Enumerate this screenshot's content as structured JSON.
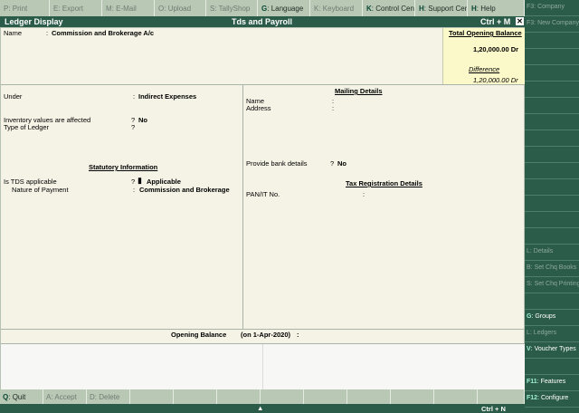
{
  "topbar": [
    {
      "key": "P",
      "label": "Print",
      "enabled": false,
      "w": 55
    },
    {
      "key": "E",
      "label": "Export",
      "enabled": false,
      "w": 58
    },
    {
      "key": "M",
      "label": "E-Mail",
      "enabled": false,
      "w": 58
    },
    {
      "key": "O",
      "label": "Upload",
      "enabled": false,
      "w": 57
    },
    {
      "key": "S",
      "label": "TallyShop",
      "enabled": false,
      "w": 57
    },
    {
      "key": "G",
      "label": "Language",
      "enabled": true,
      "w": 58
    },
    {
      "key": "K",
      "label": "Keyboard",
      "enabled": false,
      "w": 58
    },
    {
      "key": "K",
      "label": "Control Centre",
      "enabled": true,
      "w": 58
    },
    {
      "key": "H",
      "label": "Support Centre",
      "enabled": true,
      "w": 58
    },
    {
      "key": "H",
      "label": "Help",
      "enabled": true,
      "w": 63
    }
  ],
  "title": {
    "left": "Ledger Display",
    "center": "Tds and Payroll",
    "right": "Ctrl + M",
    "close": "✕"
  },
  "ledger": {
    "name_label": "Name",
    "name_value": "Commission and Brokerage A/c",
    "balance_title": "Total Opening Balance",
    "balance_value": "1,20,000.00 Dr",
    "difference_label": "Difference",
    "difference_value": "1,20,000.00 Dr",
    "under_label": "Under",
    "under_value": "Indirect Expenses",
    "inventory_label": "Inventory values are affected",
    "inventory_value": "No",
    "type_label": "Type of Ledger",
    "type_value": "",
    "statutory_title": "Statutory Information",
    "tds_label": "Is TDS applicable",
    "tds_value": "Applicable",
    "nature_label": "Nature of Payment",
    "nature_value": "Commission and Brokerage"
  },
  "mailing": {
    "title": "Mailing Details",
    "name_label": "Name",
    "address_label": "Address",
    "bank_label": "Provide bank details",
    "bank_value": "No",
    "tax_title": "Tax Registration Details",
    "pan_label": "PAN/IT No."
  },
  "opening": {
    "label": "Opening Balance",
    "date": "(on 1-Apr-2020)"
  },
  "bottombar": [
    {
      "key": "Q",
      "label": "Quit",
      "enabled": true,
      "w": 48
    },
    {
      "key": "A",
      "label": "Accept",
      "enabled": false,
      "w": 48
    },
    {
      "key": "D",
      "label": "Delete",
      "enabled": false,
      "w": 48
    },
    {
      "key": "",
      "label": "",
      "enabled": false,
      "w": 48
    },
    {
      "key": "",
      "label": "",
      "enabled": false,
      "w": 48
    },
    {
      "key": "",
      "label": "",
      "enabled": false,
      "w": 48
    },
    {
      "key": "",
      "label": "",
      "enabled": false,
      "w": 48
    },
    {
      "key": "",
      "label": "",
      "enabled": false,
      "w": 48
    },
    {
      "key": "",
      "label": "",
      "enabled": false,
      "w": 48
    },
    {
      "key": "",
      "label": "",
      "enabled": false,
      "w": 48
    },
    {
      "key": "",
      "label": "",
      "enabled": false,
      "w": 48
    },
    {
      "key": "",
      "label": "",
      "enabled": false,
      "w": 52
    }
  ],
  "statusbar": {
    "arrow": "▲",
    "shortcut": "Ctrl + N"
  },
  "rightpanel": [
    {
      "key": "F3",
      "label": "Company",
      "enabled": false
    },
    {
      "key": "F3",
      "label": "New Company",
      "enabled": false
    },
    {
      "key": "",
      "label": "",
      "enabled": false
    },
    {
      "key": "",
      "label": "",
      "enabled": false
    },
    {
      "key": "",
      "label": "",
      "enabled": false
    },
    {
      "key": "",
      "label": "",
      "enabled": false
    },
    {
      "key": "",
      "label": "",
      "enabled": false
    },
    {
      "key": "",
      "label": "",
      "enabled": false
    },
    {
      "key": "",
      "label": "",
      "enabled": false
    },
    {
      "key": "",
      "label": "",
      "enabled": false
    },
    {
      "key": "",
      "label": "",
      "enabled": false
    },
    {
      "key": "",
      "label": "",
      "enabled": false
    },
    {
      "key": "",
      "label": "",
      "enabled": false
    },
    {
      "key": "",
      "label": "",
      "enabled": false
    },
    {
      "key": "",
      "label": "",
      "enabled": false
    },
    {
      "key": "L",
      "label": "Details",
      "enabled": false
    },
    {
      "key": "B",
      "label": "Set Chq Books",
      "enabled": false
    },
    {
      "key": "S",
      "label": "Set Chq Printing",
      "enabled": false
    },
    {
      "key": "",
      "label": "",
      "enabled": false
    },
    {
      "key": "G",
      "label": "Groups",
      "enabled": true
    },
    {
      "key": "L",
      "label": "Ledgers",
      "enabled": false
    },
    {
      "key": "V",
      "label": "Voucher Types",
      "enabled": true
    },
    {
      "key": "",
      "label": "",
      "enabled": false
    },
    {
      "key": "F11",
      "label": "Features",
      "enabled": true
    },
    {
      "key": "F12",
      "label": "Configure",
      "enabled": true
    }
  ],
  "colors": {
    "accent": "#2b5b49",
    "bar": "#b9c7b5",
    "panel": "#f5f3e6",
    "balance_box": "#fbf8c9"
  }
}
